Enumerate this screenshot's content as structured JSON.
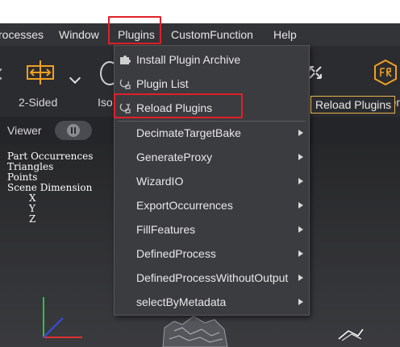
{
  "menubar": {
    "items": [
      "rocesses",
      "Window",
      "Plugins",
      "CustomFunction",
      "Help"
    ]
  },
  "toolbar": {
    "two_sided_label": "2-Sided",
    "iso_label": "Iso",
    "other_label": "Other"
  },
  "viewer": {
    "label": "Viewer"
  },
  "scene_info": {
    "lines": [
      "Part Occurrences",
      "Triangles",
      "Points",
      "Scene Dimension",
      "X",
      "Y",
      "Z"
    ]
  },
  "plugins_menu": {
    "items": [
      {
        "label": "Install Plugin Archive",
        "icon": "puzzle-icon"
      },
      {
        "label": "Plugin List",
        "icon": "puzzle-outline-icon"
      },
      {
        "label": "Reload Plugins",
        "icon": "reload-puzzle-icon"
      }
    ],
    "submenus": [
      "DecimateTargetBake",
      "GenerateProxy",
      "WizardIO",
      "ExportOccurrences",
      "FillFeatures",
      "DefinedProcess",
      "DefinedProcessWithoutOutput",
      "selectByMetadata"
    ]
  },
  "tooltip": {
    "text": "Reload Plugins"
  },
  "colors": {
    "highlight": "#e0202a",
    "tool_icon": "#f0a020",
    "tooltip_border": "#e8b24a"
  }
}
